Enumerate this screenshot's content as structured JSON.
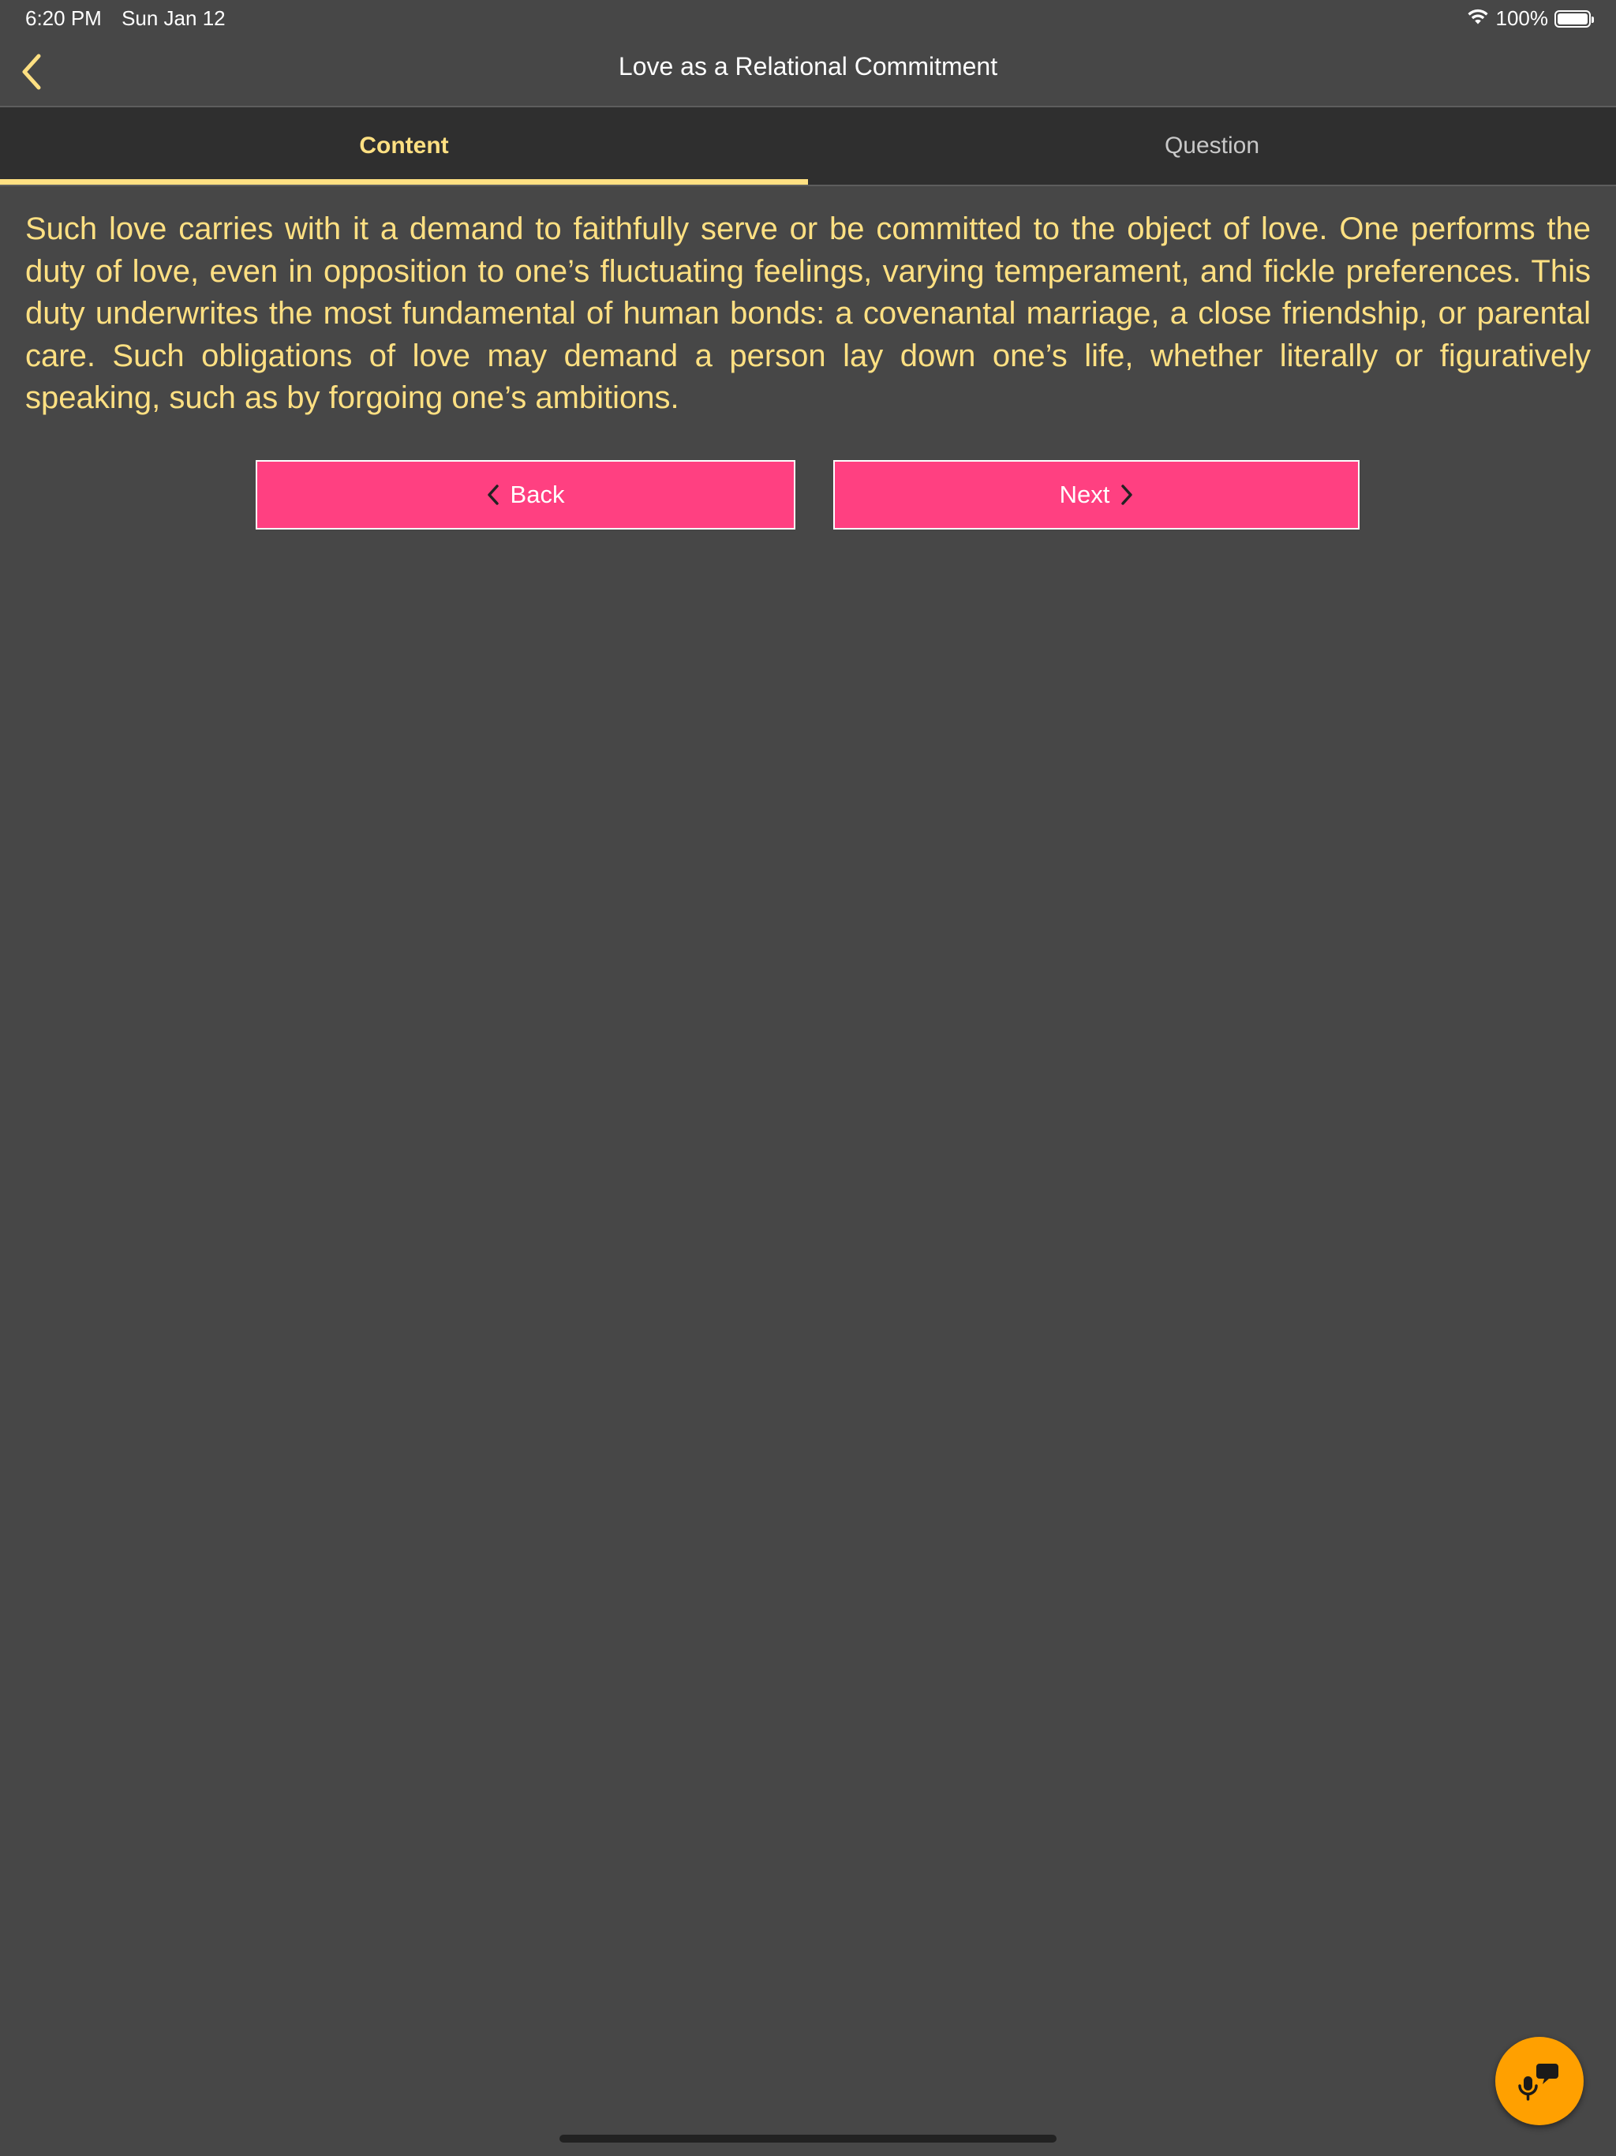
{
  "status_bar": {
    "time": "6:20 PM",
    "date": "Sun Jan 12",
    "battery_percent": "100%",
    "battery_level": 1.0
  },
  "nav": {
    "title": "Love as a Relational Commitment",
    "back_icon": "chevron-left-icon"
  },
  "tabs": [
    {
      "label": "Content",
      "active": true
    },
    {
      "label": "Question",
      "active": false
    }
  ],
  "content": {
    "paragraph": "Such love carries with it a demand to faithfully serve or be committed to the object of love. One performs the duty of love, even in opposition to one’s fluctuating feelings, varying temperament, and fickle preferences. This duty underwrites the most fundamental of human bonds: a covenantal marriage, a close friendship, or parental care. Such obligations of love may demand a person lay down one’s life, whether literally or figuratively speaking, such as by forgoing one’s ambitions."
  },
  "buttons": {
    "back_label": "Back",
    "next_label": "Next"
  },
  "fab": {
    "icon": "mic-chat-icon"
  },
  "colors": {
    "background": "#474747",
    "tab_bar": "#2f2f2f",
    "accent_yellow": "#ffe082",
    "button_pink": "#ff4081",
    "fab_orange": "#ffa000"
  }
}
